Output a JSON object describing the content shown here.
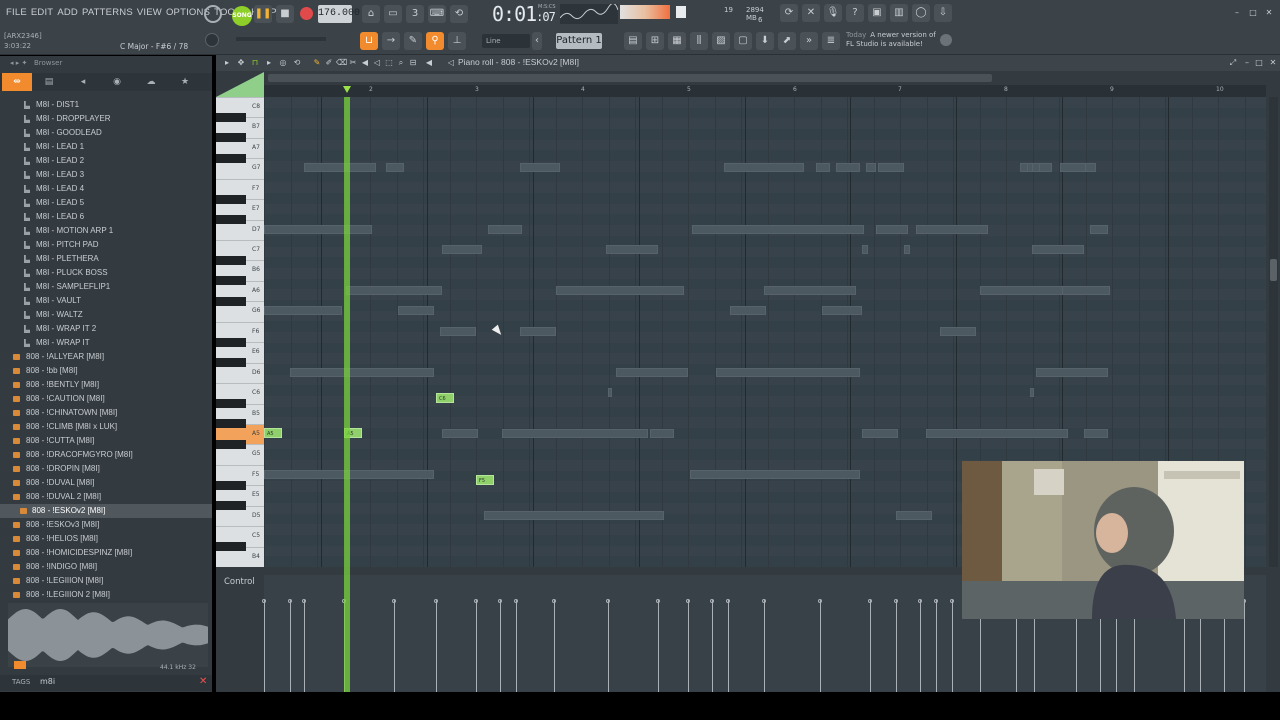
{
  "menu": [
    "FILE",
    "EDIT",
    "ADD",
    "PATTERNS",
    "VIEW",
    "OPTIONS",
    "TOOLS",
    "HELP"
  ],
  "transport": {
    "song_label": "SONG",
    "tempo": "176.000",
    "time_main": "0:01",
    "time_sub": ":07",
    "time_unit": "M:S:CS"
  },
  "status": {
    "hint_line1": "[ARX2346]",
    "hint_line2": "3:03:22",
    "key": "C Major - F#6 / 78",
    "cpu_num": "19",
    "ram": "2894 MB",
    "voices": "6"
  },
  "toolbar2": {
    "snap": "Line",
    "pattern": "Pattern 1"
  },
  "news": {
    "date": "Today",
    "line1": "A newer version of",
    "line2": "FL Studio is available!"
  },
  "browser": {
    "title": "Browser",
    "items": [
      {
        "label": "M8I - DIST1",
        "type": "sub"
      },
      {
        "label": "M8I - DROPPLAYER",
        "type": "sub"
      },
      {
        "label": "M8I - GOODLEAD",
        "type": "sub"
      },
      {
        "label": "M8I - LEAD 1",
        "type": "sub"
      },
      {
        "label": "M8I - LEAD 2",
        "type": "sub"
      },
      {
        "label": "M8I - LEAD 3",
        "type": "sub"
      },
      {
        "label": "M8I - LEAD 4",
        "type": "sub"
      },
      {
        "label": "M8I - LEAD 5",
        "type": "sub"
      },
      {
        "label": "M8I - LEAD 6",
        "type": "sub"
      },
      {
        "label": "M8I - MOTION ARP 1",
        "type": "sub"
      },
      {
        "label": "M8I - PITCH PAD",
        "type": "sub"
      },
      {
        "label": "M8I - PLETHERA",
        "type": "sub"
      },
      {
        "label": "M8I - PLUCK BOSS",
        "type": "sub"
      },
      {
        "label": "M8I - SAMPLEFLIP1",
        "type": "sub"
      },
      {
        "label": "M8I - VAULT",
        "type": "sub"
      },
      {
        "label": "M8I - WALTZ",
        "type": "sub"
      },
      {
        "label": "M8I - WRAP IT 2",
        "type": "sub"
      },
      {
        "label": "M8I - WRAP IT",
        "type": "sub"
      },
      {
        "label": "808 - !ALLYEAR [M8I]",
        "type": "folder"
      },
      {
        "label": "808 - !bb [M8I]",
        "type": "folder"
      },
      {
        "label": "808 - !BENTLY [M8I]",
        "type": "folder"
      },
      {
        "label": "808 - !CAUTION [M8I]",
        "type": "folder"
      },
      {
        "label": "808 - !CHINATOWN [M8I]",
        "type": "folder"
      },
      {
        "label": "808 - !CLIMB [M8I x LUK]",
        "type": "folder"
      },
      {
        "label": "808 - !CUTTA [M8I]",
        "type": "folder"
      },
      {
        "label": "808 - !DRACOFMGYRO [M8I]",
        "type": "folder"
      },
      {
        "label": "808 - !DROPIN [M8I]",
        "type": "folder"
      },
      {
        "label": "808 - !DUVAL [M8I]",
        "type": "folder"
      },
      {
        "label": "808 - !DUVAL 2 [M8I]",
        "type": "folder"
      },
      {
        "label": "808 - !ESKOv2 [M8I]",
        "type": "selected"
      },
      {
        "label": "808 - !ESKOv3 [M8I]",
        "type": "folder"
      },
      {
        "label": "808 - !HELIOS [M8I]",
        "type": "folder"
      },
      {
        "label": "808 - !HOMICIDESPINZ [M8I]",
        "type": "folder"
      },
      {
        "label": "808 - !INDIGO [M8I]",
        "type": "folder"
      },
      {
        "label": "808 - !LEGIIION [M8I]",
        "type": "folder"
      },
      {
        "label": "808 - !LEGIIION 2 [M8I]",
        "type": "folder"
      }
    ],
    "wave_info": "44.1 kHz 32",
    "tags_label": "TAGS",
    "tags_value": "m8i"
  },
  "piano_roll": {
    "title": "Piano roll - 808 - !ESKOv2 [M8I]",
    "ruler": [
      "2",
      "3",
      "4",
      "5",
      "6",
      "7",
      "8",
      "9",
      "10"
    ],
    "key_labels": [
      "C8",
      "B7",
      "A7",
      "G7",
      "F7",
      "E7",
      "D7",
      "C7",
      "B6",
      "A6",
      "G6",
      "F6",
      "E6",
      "D6",
      "C6",
      "B5",
      "A5",
      "G5",
      "F5",
      "E5",
      "D5",
      "C5",
      "B4"
    ],
    "control_label": "Control",
    "active_notes": [
      {
        "label": "C6"
      },
      {
        "label": "A5"
      },
      {
        "label": "A5"
      },
      {
        "label": "F5"
      }
    ],
    "colors": {
      "note_ghost": "#4d5960",
      "note_active": "#8fd06a",
      "playhead": "#78d23c",
      "accent": "#f28a2e"
    }
  }
}
